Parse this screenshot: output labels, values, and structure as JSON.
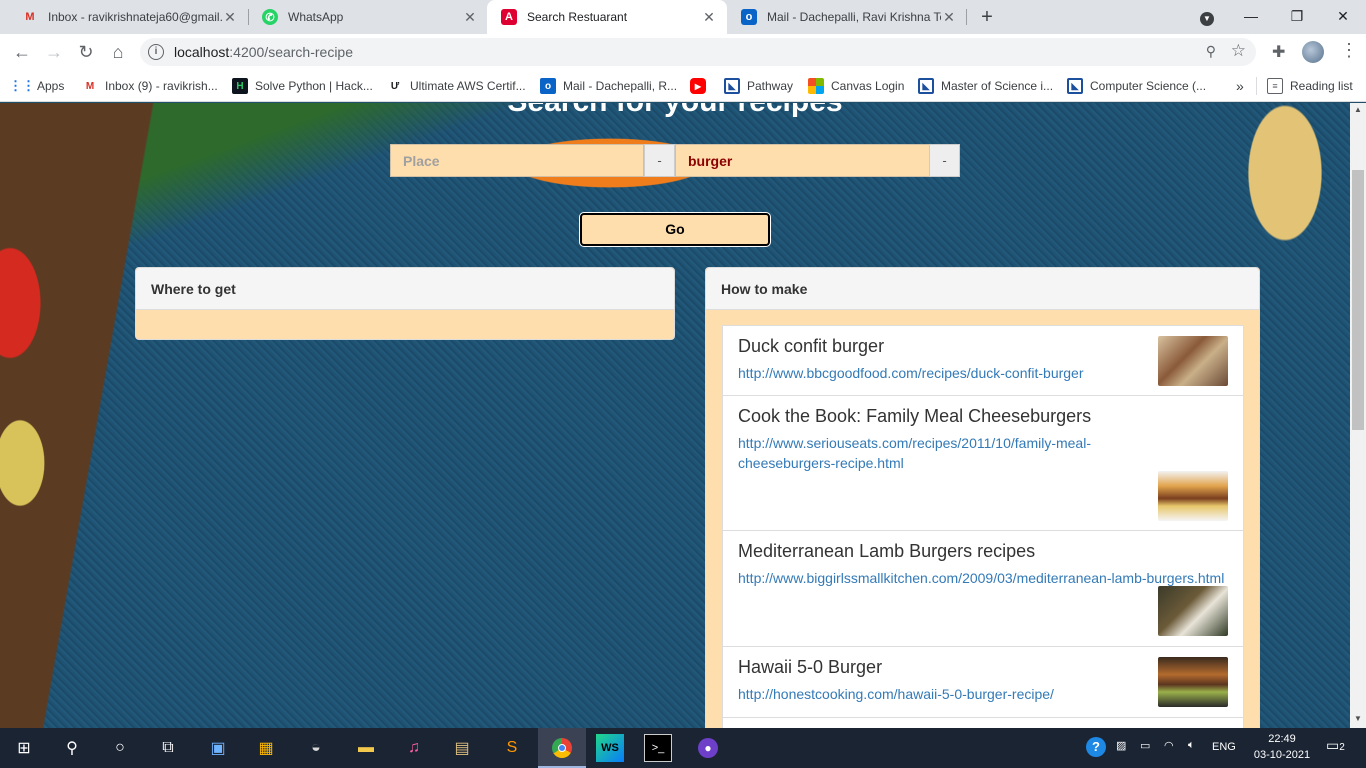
{
  "browser": {
    "tabs": [
      {
        "title": "Inbox - ravikrishnateja60@gmail.",
        "icon": "gmail-icon",
        "active": false
      },
      {
        "title": "WhatsApp",
        "icon": "whatsapp-icon",
        "active": false
      },
      {
        "title": "Search Restuarant",
        "icon": "angular-icon",
        "active": true
      },
      {
        "title": "Mail - Dachepalli, Ravi Krishna Te",
        "icon": "outlook-icon",
        "active": false
      }
    ],
    "url_host": "localhost",
    "url_path": ":4200/search-recipe",
    "bookmarks": [
      {
        "label": "Apps",
        "icon": "apps-grid-icon"
      },
      {
        "label": "Inbox (9) - ravikrish...",
        "icon": "gmail-icon"
      },
      {
        "label": "Solve Python | Hack...",
        "icon": "hackerrank-icon"
      },
      {
        "label": "Ultimate AWS Certif...",
        "icon": "udemy-icon"
      },
      {
        "label": "Mail - Dachepalli, R...",
        "icon": "outlook-icon"
      },
      {
        "label": "",
        "icon": "youtube-icon"
      },
      {
        "label": "Pathway",
        "icon": "pathway-icon"
      },
      {
        "label": "Canvas Login",
        "icon": "microsoft-icon"
      },
      {
        "label": "Master of Science i...",
        "icon": "pathway-icon"
      },
      {
        "label": "Computer Science (...",
        "icon": "pathway-icon"
      }
    ],
    "reading_list": "Reading list",
    "overflow": "»"
  },
  "page": {
    "heading": "Search for your recipes",
    "place_placeholder": "Place",
    "place_addon": "-",
    "dish_value": "burger",
    "dish_addon": "-",
    "go_label": "Go",
    "where_title": "Where to get",
    "how_title": "How to make",
    "recipes": [
      {
        "name": "Duck confit burger",
        "url": "http://www.bbcgoodfood.com/recipes/duck-confit-burger"
      },
      {
        "name": "Cook the Book: Family Meal Cheeseburgers",
        "url": "http://www.seriouseats.com/recipes/2011/10/family-meal-cheeseburgers-recipe.html"
      },
      {
        "name": "Mediterranean Lamb Burgers recipes",
        "url": "http://www.biggirlssmallkitchen.com/2009/03/mediterranean-lamb-burgers.html"
      },
      {
        "name": "Hawaii 5-0 Burger",
        "url": "http://honestcooking.com/hawaii-5-0-burger-recipe/"
      }
    ]
  },
  "taskbar": {
    "lang": "ENG",
    "time": "22:49",
    "date": "03-10-2021",
    "notifications": "2"
  },
  "colors": {
    "accent_field": "#ffdead",
    "dish_text": "#8b0000",
    "link": "#337ab7"
  }
}
